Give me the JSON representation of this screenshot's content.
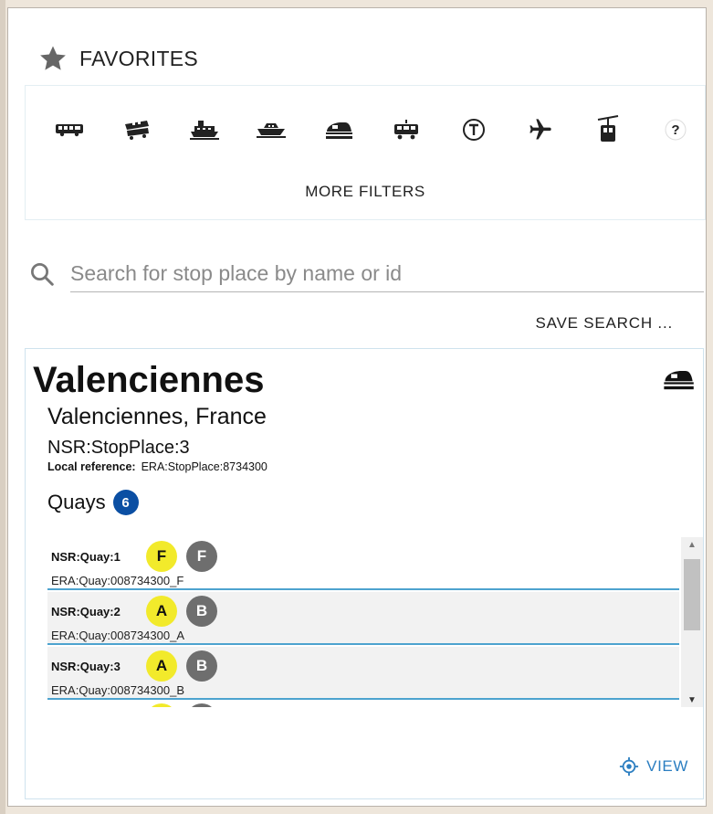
{
  "favorites": {
    "label": "FAVORITES",
    "icon": "star-icon"
  },
  "filters": {
    "modes": [
      {
        "name": "bus",
        "icon": "bus-icon"
      },
      {
        "name": "coach",
        "icon": "coach-icon"
      },
      {
        "name": "ferry",
        "icon": "ferry-icon"
      },
      {
        "name": "water",
        "icon": "boat-icon"
      },
      {
        "name": "rail",
        "icon": "train-icon"
      },
      {
        "name": "tram",
        "icon": "tram-icon"
      },
      {
        "name": "metro",
        "icon": "metro-t-icon",
        "glyph": "T"
      },
      {
        "name": "air",
        "icon": "airplane-icon"
      },
      {
        "name": "cableway",
        "icon": "cable-car-icon"
      },
      {
        "name": "unknown",
        "icon": "question-icon",
        "glyph": "?"
      }
    ],
    "more_label": "MORE FILTERS"
  },
  "search": {
    "placeholder": "Search for stop place by name or id",
    "value": ""
  },
  "save_search_label": "SAVE SEARCH ...",
  "stop": {
    "name": "Valenciennes",
    "subtitle": "Valenciennes, France",
    "id": "NSR:StopPlace:3",
    "local_ref_label": "Local reference:",
    "local_ref_value": "ERA:StopPlace:8734300",
    "mode_icon": "train-icon",
    "quays_label": "Quays",
    "quays_count": "6",
    "quays": [
      {
        "id": "NSR:Quay:1",
        "public_code": "F",
        "private_code": "F",
        "ref": "ERA:Quay:008734300_F"
      },
      {
        "id": "NSR:Quay:2",
        "public_code": "A",
        "private_code": "B",
        "ref": "ERA:Quay:008734300_A"
      },
      {
        "id": "NSR:Quay:3",
        "public_code": "A",
        "private_code": "B",
        "ref": "ERA:Quay:008734300_B"
      }
    ]
  },
  "view_label": "VIEW",
  "colors": {
    "accent": "#2b7ec1",
    "quay_divider": "#4da3cf",
    "count_badge": "#0b4fa3",
    "public_code": "#f2ea2b",
    "private_code": "#6e6e6e"
  }
}
